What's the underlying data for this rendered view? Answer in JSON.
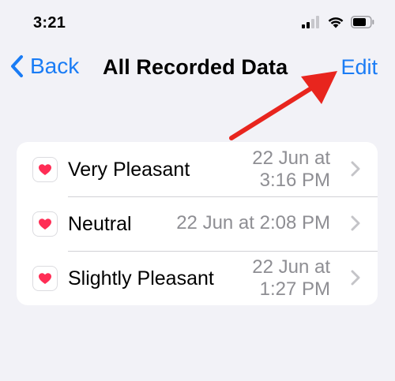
{
  "status_bar": {
    "time": "3:21"
  },
  "nav": {
    "back_label": "Back",
    "title": "All Recorded Data",
    "edit_label": "Edit"
  },
  "colors": {
    "accent": "#1a7cf5",
    "annotation_arrow": "#e8251e",
    "heart": "#ff2d55",
    "secondary_text": "#8e8e93"
  },
  "records": [
    {
      "label": "Very Pleasant",
      "timestamp_line1": "22 Jun at",
      "timestamp_line2": "3:16 PM"
    },
    {
      "label": "Neutral",
      "timestamp": "22 Jun at 2:08 PM"
    },
    {
      "label": "Slightly Pleasant",
      "timestamp_line1": "22 Jun at",
      "timestamp_line2": "1:27 PM"
    }
  ]
}
